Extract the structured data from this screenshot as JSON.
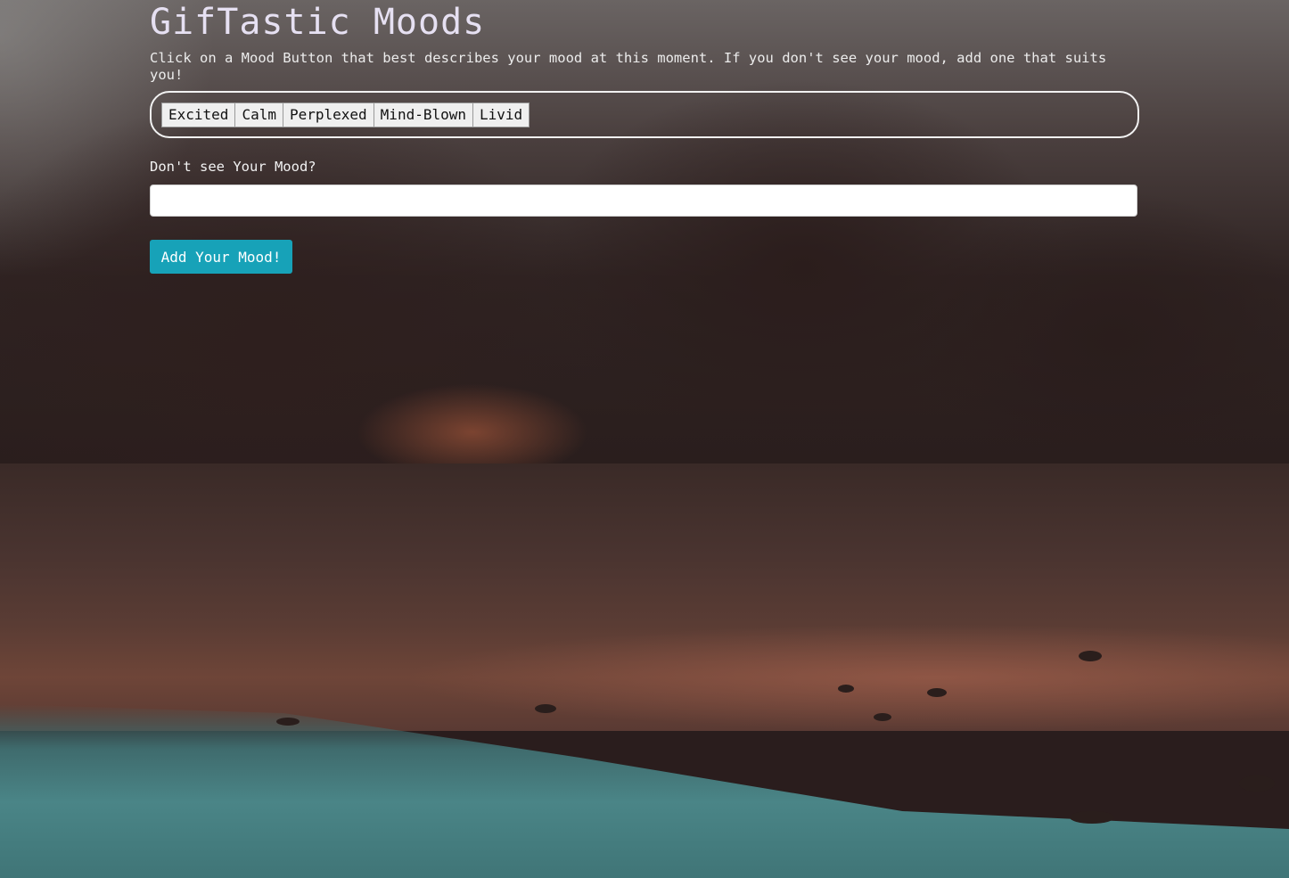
{
  "page": {
    "title": "GifTastic Moods",
    "instructions": "Click on a Mood Button that best describes your mood at this moment. If you don't see your mood, add one that suits you!"
  },
  "moods": {
    "buttons": [
      "Excited",
      "Calm",
      "Perplexed",
      "Mind-Blown",
      "Livid"
    ]
  },
  "add_mood": {
    "label": "Don't see Your Mood?",
    "input_value": "",
    "button_label": "Add Your Mood!"
  },
  "colors": {
    "accent_button": "#17a2b8",
    "title_text": "#e6e0f2",
    "mood_button_bg": "#efefef"
  },
  "background": {
    "image": "forest-lake-shore-photo"
  }
}
